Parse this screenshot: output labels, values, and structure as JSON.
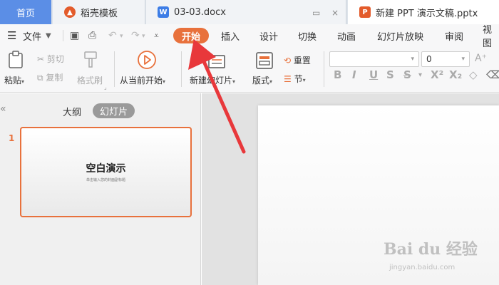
{
  "tabs": [
    {
      "label": "首页",
      "active": true
    },
    {
      "label": "稻壳模板",
      "icon": "docer-icon"
    },
    {
      "label": "03-03.docx",
      "icon": "word-doc-icon"
    },
    {
      "label": "新建 PPT 演示文稿.pptx",
      "icon": "ppt-doc-icon"
    }
  ],
  "menu": {
    "file_label": "文件",
    "items": [
      "开始",
      "插入",
      "设计",
      "切换",
      "动画",
      "幻灯片放映",
      "审阅",
      "视图"
    ],
    "active": "开始"
  },
  "ribbon": {
    "paste": "粘贴",
    "cut": "剪切",
    "copy": "复制",
    "format_painter": "格式刷",
    "from_current": "从当前开始",
    "new_slide": "新建幻灯片",
    "layout": "版式",
    "reset": "重置",
    "section": "节",
    "font_size_value": "0"
  },
  "panel": {
    "tab_outline": "大纲",
    "tab_slides": "幻灯片",
    "slide_number": "1",
    "thumb_title": "空白演示",
    "thumb_subtitle": "单击输入您的封面副标题"
  },
  "watermark": {
    "logo": "Bai du 经验",
    "url": "jingyan.baidu.com"
  },
  "colors": {
    "accent": "#e8713c",
    "home_tab": "#5b8ee6",
    "arrow": "#e8383b",
    "word": "#3d7de6",
    "ppt": "#e35b2b"
  }
}
